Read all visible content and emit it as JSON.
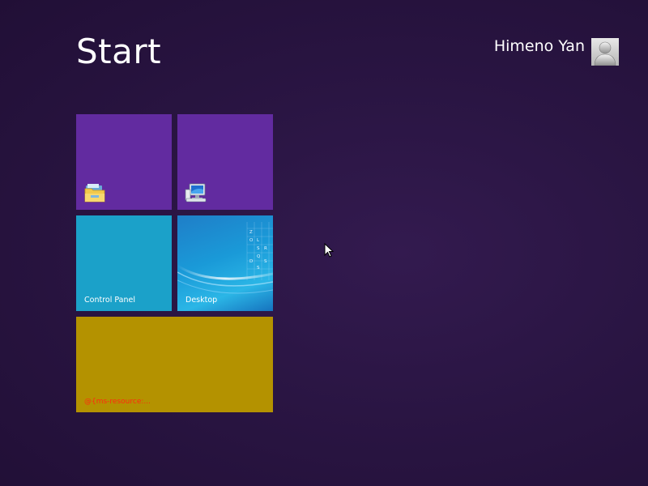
{
  "header": {
    "title": "Start",
    "user_name": "Himeno Yan"
  },
  "tiles": {
    "explorer": {
      "icon": "folder-icon",
      "label": ""
    },
    "computer": {
      "icon": "computer-icon",
      "label": ""
    },
    "control_panel": {
      "label": "Control Panel"
    },
    "desktop": {
      "label": "Desktop",
      "art_letters": [
        "Z",
        "O",
        "L",
        "S",
        "R",
        "Q",
        "D",
        "S",
        "S"
      ]
    },
    "wide": {
      "label": "@{ms-resource:..."
    }
  },
  "colors": {
    "background": "#2a1543",
    "tile_purple": "#622ba0",
    "tile_teal": "#1ba1c9",
    "tile_gold": "#b49200",
    "error_text": "#ff2a10"
  }
}
